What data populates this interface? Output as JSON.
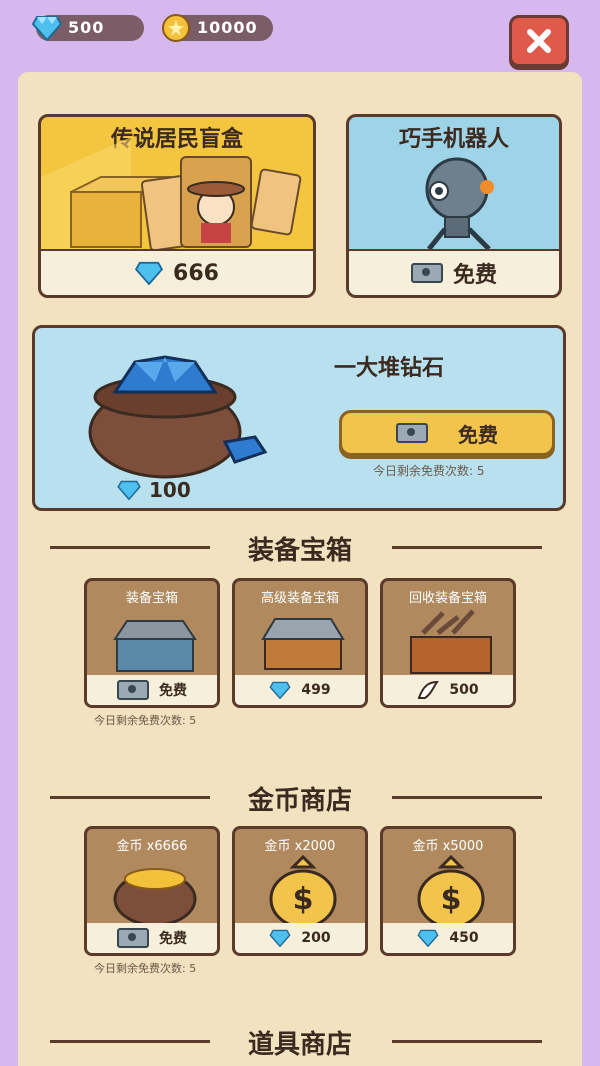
{
  "header": {
    "diamonds": "500",
    "coins": "10000",
    "close_icon": "close-icon"
  },
  "featured": {
    "legend_box": {
      "title": "传说居民盲盒",
      "price": "666",
      "icon": "diamond-icon"
    },
    "robot": {
      "title": "巧手机器人",
      "price": "免费",
      "icon": "ticket-icon"
    },
    "diamond_pile": {
      "title": "一大堆钻石",
      "amount": "100",
      "button": "免费",
      "note": "今日剩余免费次数: 5"
    }
  },
  "equipment_section": {
    "title": "装备宝箱",
    "items": [
      {
        "name": "装备宝箱",
        "price": "免费",
        "currency": "ticket"
      },
      {
        "name": "高级装备宝箱",
        "price": "499",
        "currency": "diamond"
      },
      {
        "name": "回收装备宝箱",
        "price": "500",
        "currency": "wing"
      }
    ],
    "note": "今日剩余免费次数: 5"
  },
  "coin_section": {
    "title": "金币商店",
    "items": [
      {
        "name": "金币 x6666",
        "price": "免费",
        "currency": "ticket"
      },
      {
        "name": "金币 x2000",
        "price": "200",
        "currency": "diamond"
      },
      {
        "name": "金币 x5000",
        "price": "450",
        "currency": "diamond"
      }
    ],
    "note": "今日剩余免费次数: 5"
  },
  "item_section": {
    "title": "道具商店"
  },
  "colors": {
    "accent": "#f2c44b",
    "background": "#d6b8ee",
    "panel": "#f3e2c0",
    "close": "#e05a4c"
  }
}
